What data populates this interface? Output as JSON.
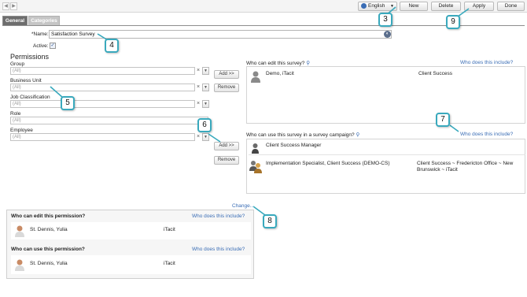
{
  "toolbar": {
    "language": "English",
    "new_label": "New",
    "delete_label": "Delete",
    "apply_label": "Apply",
    "done_label": "Done"
  },
  "tabs": [
    {
      "label": "General",
      "active": true
    },
    {
      "label": "Categories",
      "active": false
    }
  ],
  "form": {
    "name_label": "*Name:",
    "name_value": "Satisfaction Survey",
    "active_label": "Active:"
  },
  "permissions": {
    "heading": "Permissions",
    "filters": [
      {
        "label": "Group",
        "value": "(All)"
      },
      {
        "label": "Business Unit",
        "value": "(All)"
      },
      {
        "label": "Job Classification",
        "value": "(All)"
      },
      {
        "label": "Role",
        "value": "(All)"
      },
      {
        "label": "Employee",
        "value": "(All)"
      }
    ]
  },
  "edit_panel": {
    "title": "Who can edit this survey?",
    "include_link": "Who does this include?",
    "add_label": "Add >>",
    "remove_label": "Remove",
    "rows": [
      {
        "name": "Demo, iTacit",
        "detail": "Client Success"
      }
    ]
  },
  "use_panel": {
    "title": "Who can use this survey in a survey campaign?",
    "include_link": "Who does this include?",
    "add_label": "Add >>",
    "remove_label": "Remove",
    "rows": [
      {
        "name": "Client Success Manager",
        "detail": ""
      },
      {
        "name": "Implementation Specialist, Client Success (DEMO-CS)",
        "detail_line1": "Client Success ~ Fredericton Office ~ New",
        "detail_line2": "Brunswick ~ iTacit"
      }
    ]
  },
  "change_link": "Change...",
  "permission_box": {
    "edit_title": "Who can edit this permission?",
    "use_title": "Who can use this permission?",
    "include_link": "Who does this include?",
    "edit_rows": [
      {
        "name": "St. Dennis, Yulia",
        "org": "iTacit"
      }
    ],
    "use_rows": [
      {
        "name": "St. Dennis, Yulia",
        "org": "iTacit"
      }
    ]
  },
  "callouts": [
    "3",
    "4",
    "5",
    "6",
    "7",
    "8",
    "9"
  ],
  "colors": {
    "callout_border": "#39a9bd",
    "link": "#3a6db5",
    "tab_active": "#6d6d6d"
  }
}
